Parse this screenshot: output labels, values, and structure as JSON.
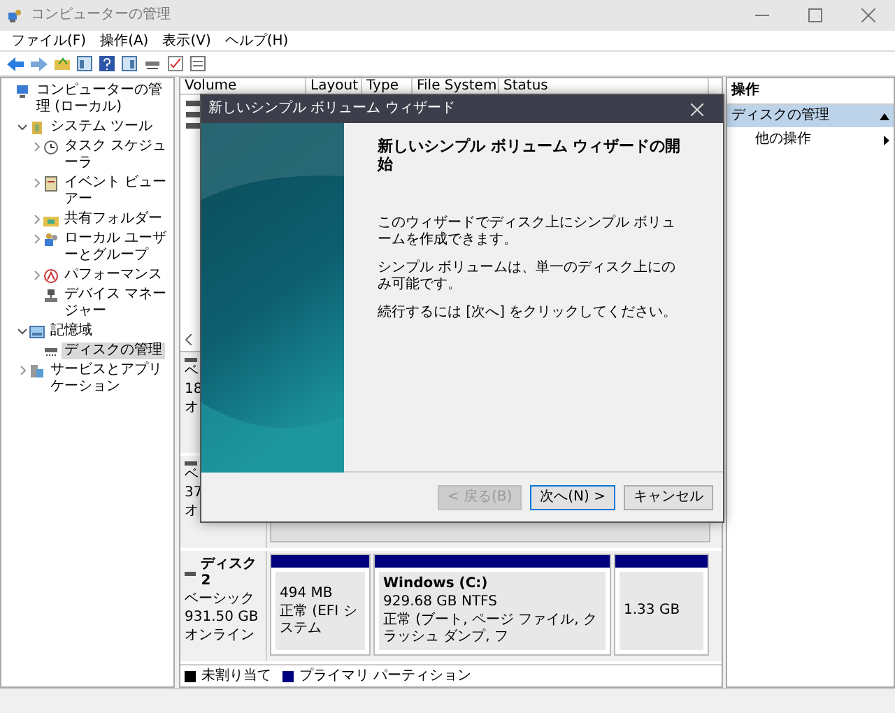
{
  "window": {
    "title": "コンピューターの管理"
  },
  "menu": [
    "ファイル(F)",
    "操作(A)",
    "表示(V)",
    "ヘルプ(H)"
  ],
  "tree": [
    {
      "label": "コンピューターの管理 (ローカル)",
      "kind": "computer",
      "selected": false,
      "children": [
        {
          "label": "システム ツール",
          "kind": "tools",
          "expanded": true,
          "selected": false,
          "children": [
            {
              "label": "タスク スケジューラ",
              "kind": "clock",
              "expanded": false,
              "selected": false
            },
            {
              "label": "イベント ビューアー",
              "kind": "log",
              "expanded": false,
              "selected": false
            },
            {
              "label": "共有フォルダー",
              "kind": "folder",
              "expanded": false,
              "selected": false
            },
            {
              "label": "ローカル ユーザーとグループ",
              "kind": "users",
              "expanded": false,
              "selected": false
            },
            {
              "label": "パフォーマンス",
              "kind": "gauge",
              "expanded": false,
              "selected": false
            },
            {
              "label": "デバイス マネージャー",
              "kind": "device",
              "selected": false
            }
          ]
        },
        {
          "label": "記憶域",
          "kind": "storage",
          "expanded": true,
          "selected": false,
          "children": [
            {
              "label": "ディスクの管理",
              "kind": "disk",
              "selected": true
            }
          ]
        },
        {
          "label": "サービスとアプリケーション",
          "kind": "services",
          "expanded": false,
          "selected": false
        }
      ]
    }
  ],
  "table": {
    "columns": [
      "Volume",
      "Layout",
      "Type",
      "File System",
      "Status"
    ]
  },
  "disks": [
    {
      "type_text": "ベ",
      "size": "18",
      "status": "オ"
    },
    {
      "type_text": "ベ",
      "size": "37",
      "status": "オ"
    },
    {
      "name": "ディスク 2",
      "type_text": "ベーシック",
      "size": "931.50 GB",
      "status": "オンライン",
      "partitions": [
        {
          "color": "#00007f",
          "size": "494 MB",
          "status": "正常 (EFI システム"
        },
        {
          "color": "#00007f",
          "name": "Windows  (C:)",
          "size": "929.68 GB NTFS",
          "status": "正常 (ブート, ページ ファイル, クラッシュ ダンプ, フ"
        },
        {
          "color": "#00007f",
          "size": "1.33 GB"
        }
      ]
    }
  ],
  "legend": [
    {
      "label": "未割り当て",
      "color": "#000000"
    },
    {
      "label": "プライマリ パーティション",
      "color": "#00007f"
    }
  ],
  "actions": {
    "header": "操作",
    "section": "ディスクの管理",
    "items": [
      "他の操作"
    ]
  },
  "dialog": {
    "title": "新しいシンプル ボリューム ウィザード",
    "heading": "新しいシンプル ボリューム ウィザードの開始",
    "paragraphs": [
      "このウィザードでディスク上にシンプル ボリュームを作成できます。",
      "シンプル ボリュームは、単一のディスク上にのみ可能です。",
      "続行するには [次へ] をクリックしてください。"
    ],
    "buttons": [
      {
        "label": "< 戻る(B)",
        "disabled": true,
        "focused": false
      },
      {
        "label": "次へ(N) >",
        "disabled": false,
        "focused": true
      },
      {
        "label": "キャンセル",
        "disabled": false,
        "focused": false
      }
    ]
  }
}
